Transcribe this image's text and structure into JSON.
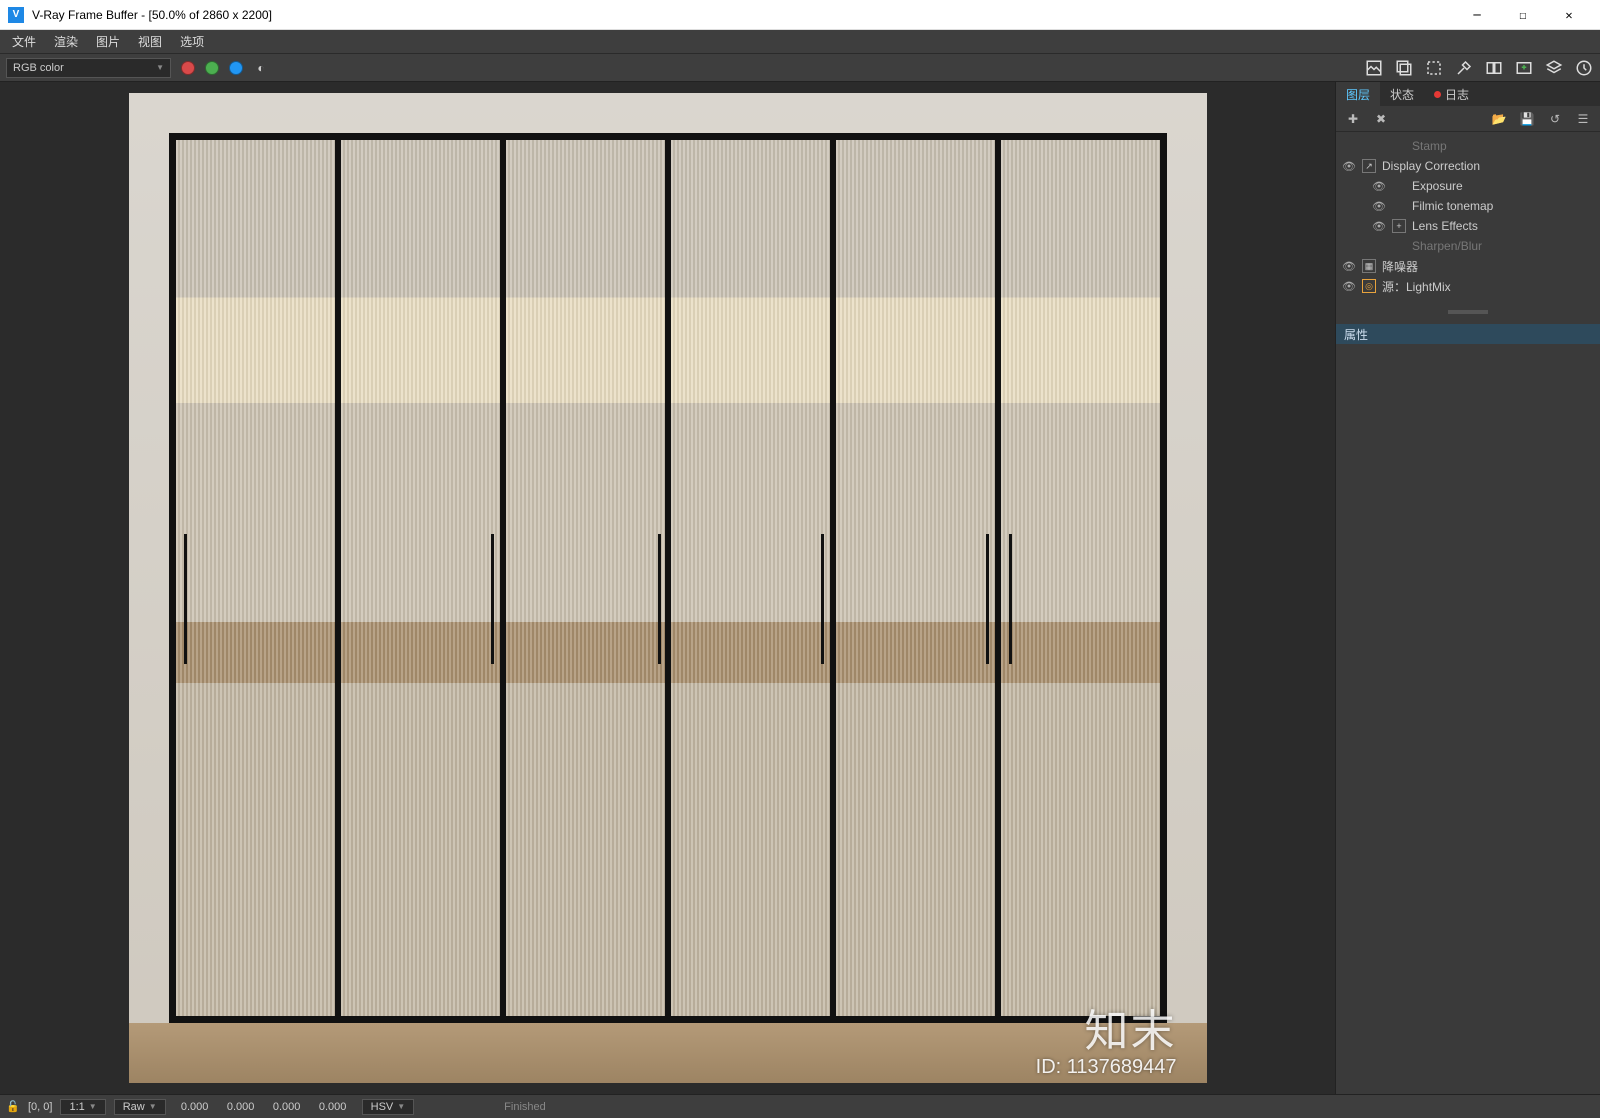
{
  "window": {
    "title": "V-Ray Frame Buffer - [50.0% of 2860 x 2200]"
  },
  "menu": {
    "file": "文件",
    "render": "渲染",
    "image": "图片",
    "view": "视图",
    "options": "选项"
  },
  "channel": {
    "label": "RGB color"
  },
  "sidebar": {
    "tabs": {
      "layers": "图层",
      "status": "状态",
      "log": "日志"
    },
    "layers": [
      {
        "label": "Stamp",
        "visible": false,
        "indent": 1,
        "dim": true
      },
      {
        "label": "Display Correction",
        "visible": true,
        "indent": 0,
        "icon": "↗"
      },
      {
        "label": "Exposure",
        "visible": true,
        "indent": 1,
        "icon": ""
      },
      {
        "label": "Filmic tonemap",
        "visible": true,
        "indent": 1,
        "icon": ""
      },
      {
        "label": "Lens Effects",
        "visible": true,
        "indent": 1,
        "icon": "+"
      },
      {
        "label": "Sharpen/Blur",
        "visible": false,
        "indent": 1,
        "dim": true
      },
      {
        "label": "降噪器",
        "visible": true,
        "indent": 0,
        "icon": "▦"
      },
      {
        "label": "源：LightMix",
        "visible": true,
        "indent": 0,
        "icon": "◎"
      }
    ],
    "properties_label": "属性"
  },
  "statusbar": {
    "coords": "[0, 0]",
    "zoom": "1:1",
    "mode": "Raw",
    "rgba": [
      "0.000",
      "0.000",
      "0.000",
      "0.000"
    ],
    "space": "HSV",
    "status": "Finished"
  },
  "watermark": {
    "brand": "知末",
    "id": "ID: 1137689447"
  }
}
